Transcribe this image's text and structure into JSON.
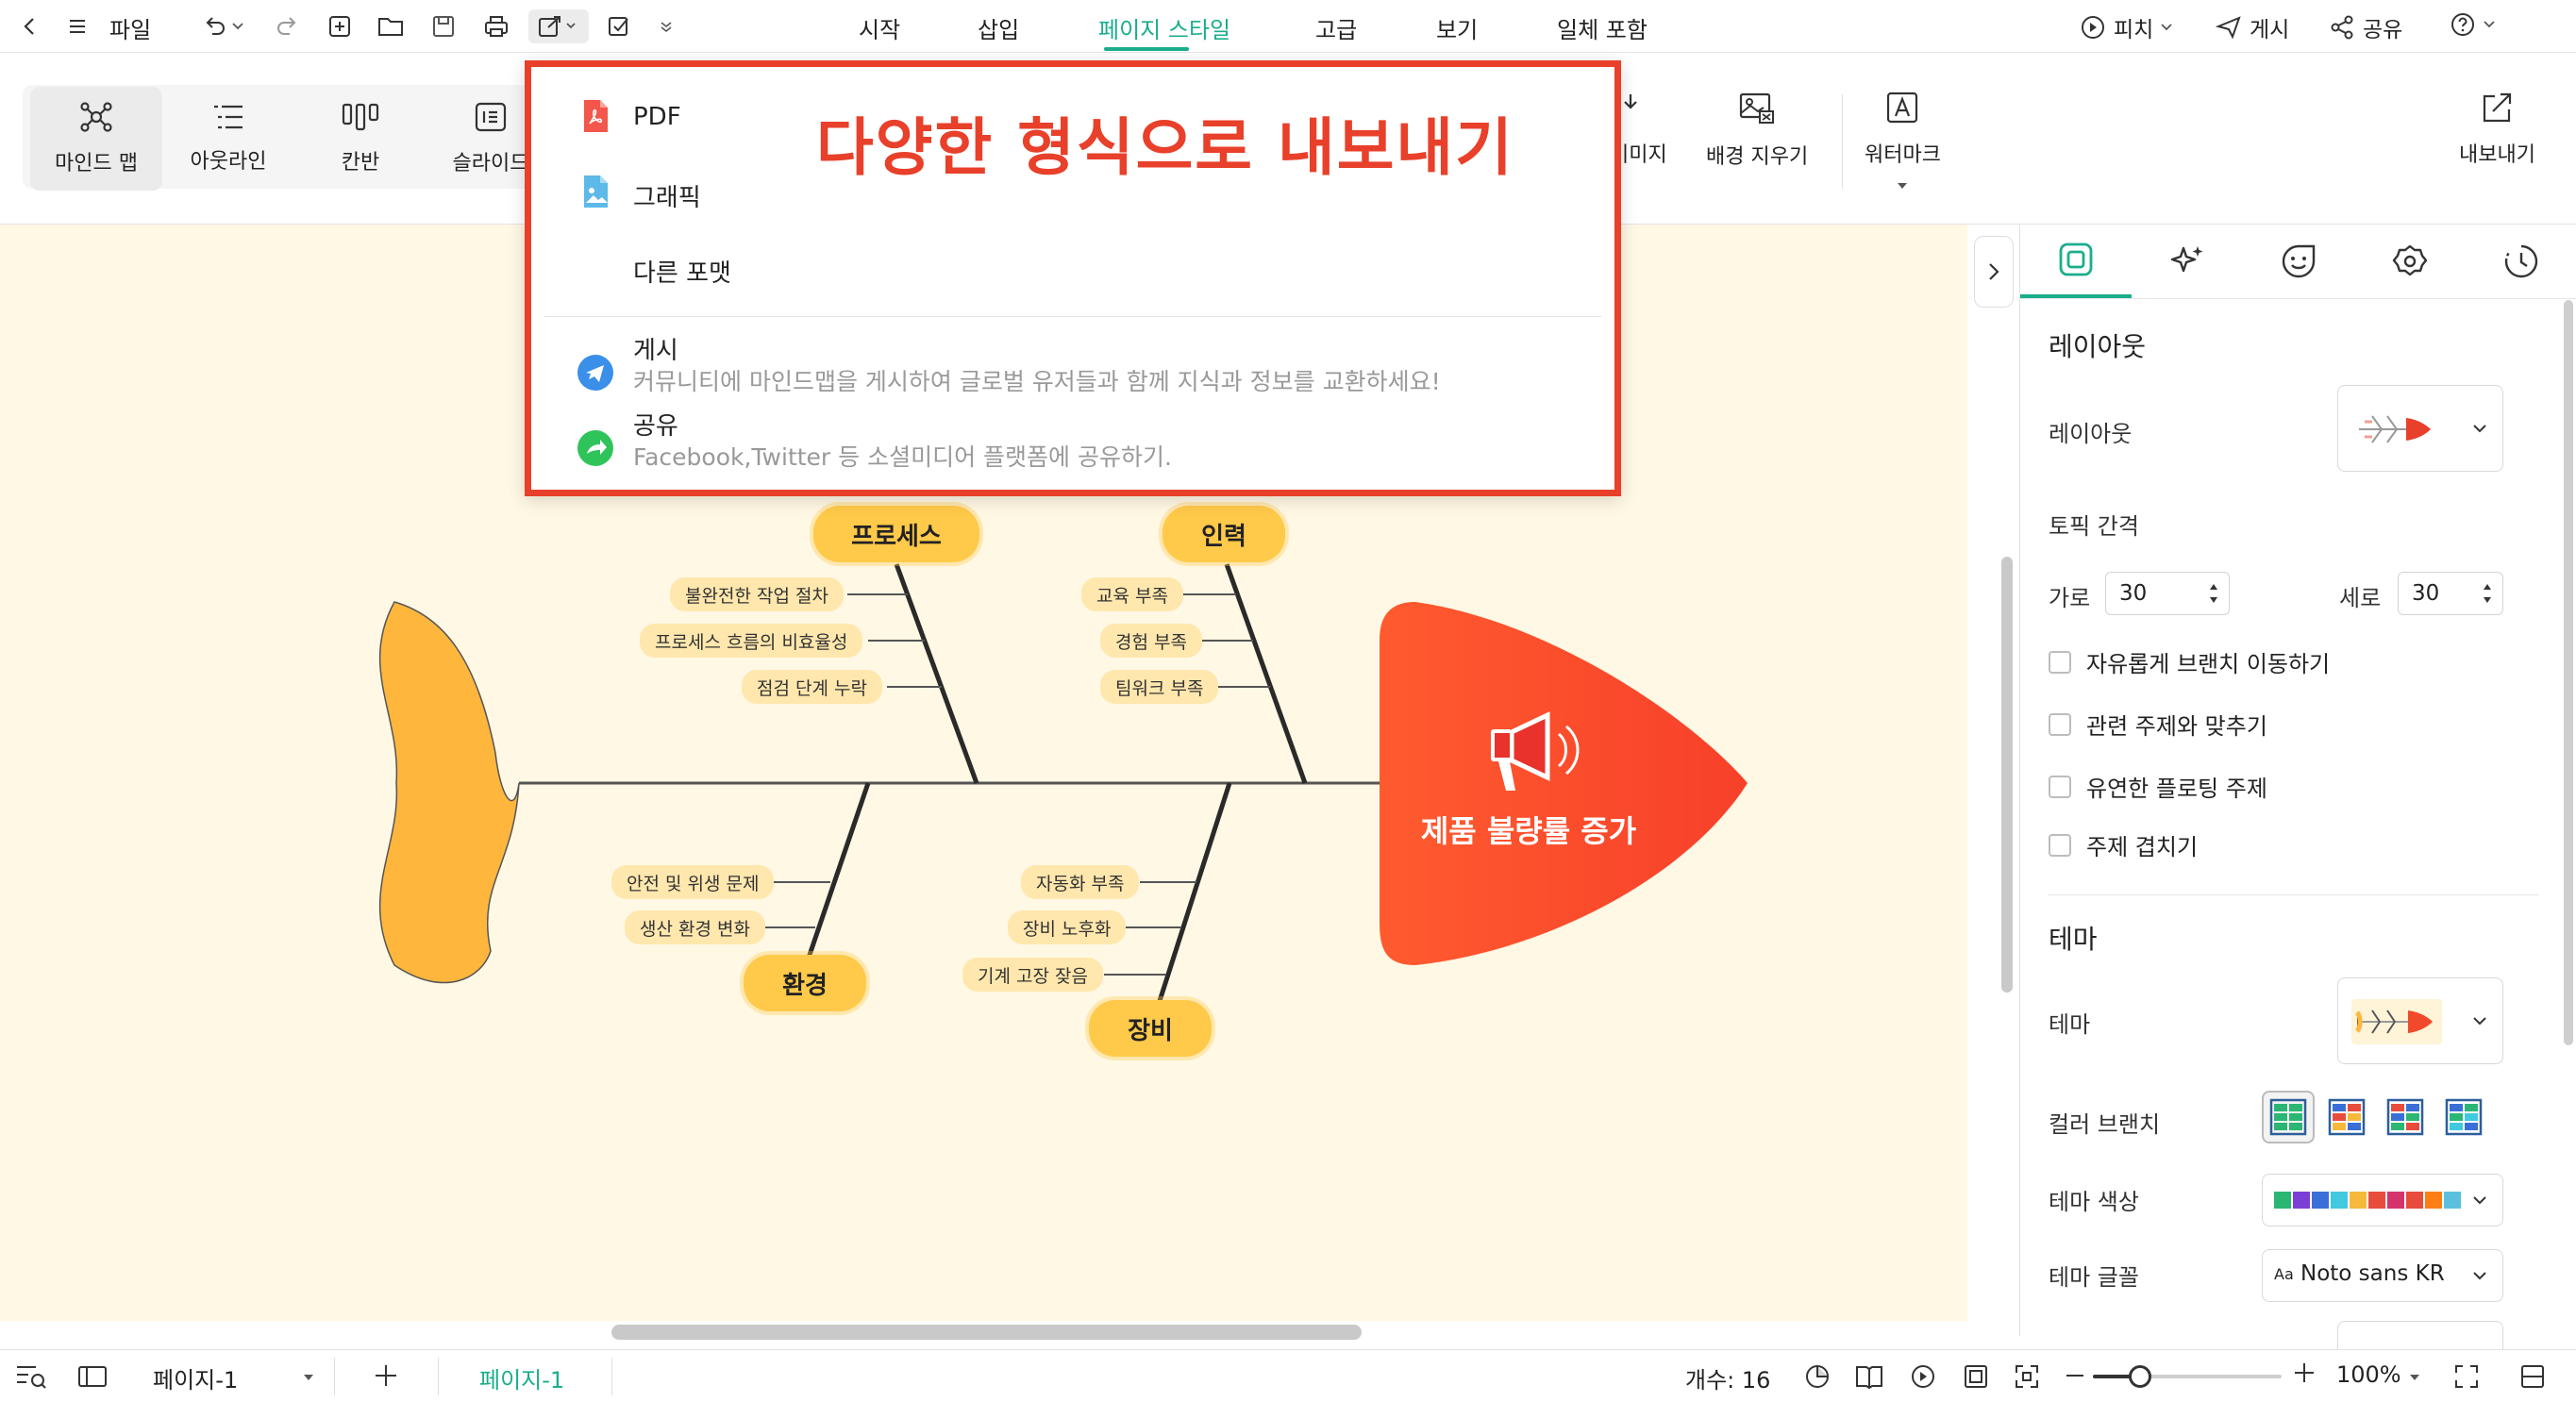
{
  "topbar": {
    "file_label": "파일",
    "menu_tabs": [
      "시작",
      "삽입",
      "페이지 스타일",
      "고급",
      "보기",
      "일체 포함"
    ],
    "right": {
      "pitch": "피치",
      "publish": "게시",
      "share": "공유"
    }
  },
  "ribbon": {
    "view_modes": [
      "마인드 맵",
      "아웃라인",
      "칸반",
      "슬라이드"
    ],
    "image_label": "이미지",
    "remove_bg_label": "배경 지우기",
    "watermark_label": "워터마크",
    "export_label": "내보내기"
  },
  "export_menu": {
    "overlay_title": "다양한 형식으로 내보내기",
    "pdf": "PDF",
    "graphic": "그래픽",
    "other": "다른 포맷",
    "publish_title": "게시",
    "publish_desc": "커뮤니티에 마인드맵을 게시하여 글로벌 유저들과 함께 지식과 정보를 교환하세요!",
    "share_title": "공유",
    "share_desc": "Facebook,Twitter 등 소셜미디어 플랫폼에 공유하기."
  },
  "diagram": {
    "head": "제품 불량률 증가",
    "categories": {
      "process": "프로세스",
      "people": "인력",
      "environment": "환경",
      "equipment": "장비"
    },
    "process_causes": [
      "불완전한 작업 절차",
      "프로세스 흐름의 비효율성",
      "점검 단계 누락"
    ],
    "people_causes": [
      "교육 부족",
      "경험 부족",
      "팀워크 부족"
    ],
    "environment_causes": [
      "안전 및 위생 문제",
      "생산 환경 변화"
    ],
    "equipment_causes": [
      "자동화 부족",
      "장비 노후화",
      "기계 고장 잦음"
    ]
  },
  "panel": {
    "layout_heading": "레이아웃",
    "layout_label": "레이아웃",
    "topic_spacing": "토픽 간격",
    "horizontal_label": "가로",
    "horizontal_value": "30",
    "vertical_label": "세로",
    "vertical_value": "30",
    "checkboxes": [
      "자유롭게 브랜치 이동하기",
      "관련 주제와 맞추기",
      "유연한 플로팅 주제",
      "주제 겹치기"
    ],
    "theme_heading": "테마",
    "theme_label": "테마",
    "color_branch": "컬러 브랜치",
    "theme_color": "테마 색상",
    "theme_font": "테마 글꼴",
    "font_prefix": "Aa",
    "font_value": "Noto sans KR",
    "palette": [
      "#2bb673",
      "#7b3fd6",
      "#3a6fd8",
      "#40c9e0",
      "#f6b93b",
      "#e84c3d",
      "#d6336c",
      "#e74c3c",
      "#fd7e14",
      "#5bc0de"
    ]
  },
  "bottombar": {
    "page_selector": "페이지-1",
    "page_tab": "페이지-1",
    "count": "개수: 16",
    "zoom": "100%"
  }
}
